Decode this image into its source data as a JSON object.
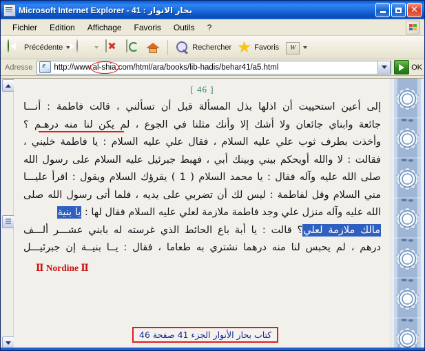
{
  "window": {
    "title": "بحار الانوار : 41 - Microsoft Internet Explorer",
    "icon": "ie-document-icon",
    "controls": {
      "minimize": "_",
      "maximize": "▫",
      "close": "✕"
    }
  },
  "menubar": {
    "items": [
      {
        "label": "Fichier"
      },
      {
        "label": "Edition"
      },
      {
        "label": "Affichage"
      },
      {
        "label": "Favoris"
      },
      {
        "label": "Outils"
      },
      {
        "label": "?"
      }
    ]
  },
  "toolbar": {
    "back_label": "Précédente",
    "forward_label": "",
    "stop_label": "",
    "refresh_label": "",
    "home_label": "",
    "search_label": "Rechercher",
    "favorites_label": "Favoris",
    "media_label": "W"
  },
  "address": {
    "label": "Adresse",
    "url_before": "http://www.",
    "url_circled": "al-shia",
    "url_after": ".com/html/ara/books/lib-hadis/behar41/a5.html",
    "go_label": "OK"
  },
  "page": {
    "page_number": "[ 46 ]",
    "lines": [
      "إلى أعين استحييت أن اذلها بذل المسألة قبل أن تسألني ، قالت فاطمة : أنـــا",
      "جائعة وابناي جائعان ولا أشك إلا وأنك مثلنا في الجوع ، لم يكن لنا منه درهـم ؟",
      "وأخذت بطرف ثوب علي عليه السلام ، فقال علي عليه السلام : يا فاطمة خليني ،",
      "فقالت : لا والله أويحكم بيني وبينك أبي ، فهبط جبرئيل عليه السلام على رسول الله",
      "صلى الله عليه وآله فقال : يا محمد السلام ( 1 ) يقرؤك السلام ويقول : اقرأ عليـــا",
      "مني السلام وقل لفاطمة : ليس لك أن تضربي على يديه ، فلما أتى رسول الله صلى",
      "الله عليه وآله منزل علي وجد فاطمة ملازمة لعلي عليه السلام فقال لها :",
      "؟ قالت : يا أبة باع الحائط الذي غرسته له بابني عشـــر ألـــف",
      "درهم ، لم يحبس لنا منه درهما نشتري به طعاما ، فقال : يــا بنيــة إن جبرئيـــل"
    ],
    "selected_text_line7": "يا بنية",
    "selected_text_line8": "مالك ملازمة لعلي",
    "watermark": "Ⅱ Nordine Ⅱ",
    "citation": "كتاب بحار الأنوار الجزء 41 صفحة 46"
  },
  "colors": {
    "title_bar": "#1268e4",
    "page_number": "#2f7d6e",
    "selection": "#2f5fbf",
    "underline_red": "#e01b1b",
    "watermark_red": "#cc1111",
    "citation_blue": "#1a2a8c"
  }
}
